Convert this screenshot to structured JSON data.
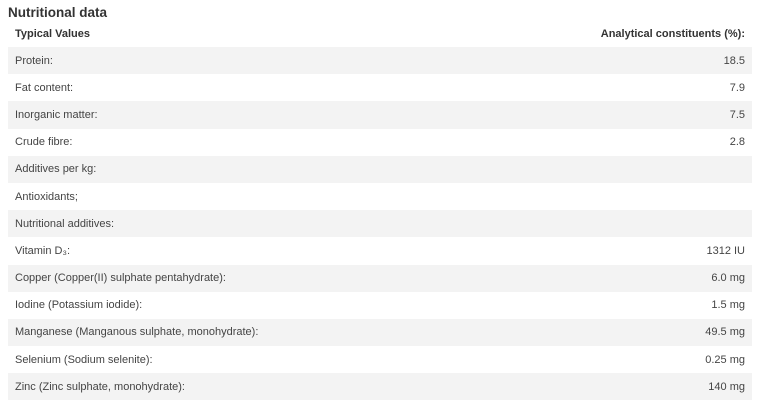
{
  "title": "Nutritional data",
  "table": {
    "header": {
      "label": "Typical Values",
      "value": "Analytical constituents (%):"
    },
    "rows": [
      {
        "label": "Protein:",
        "value": "18.5"
      },
      {
        "label": "Fat content:",
        "value": "7.9"
      },
      {
        "label": "Inorganic matter:",
        "value": "7.5"
      },
      {
        "label": "Crude fibre:",
        "value": "2.8"
      },
      {
        "label": "Additives per kg:",
        "value": ""
      },
      {
        "label": "Antioxidants;",
        "value": ""
      },
      {
        "label": "Nutritional additives:",
        "value": ""
      },
      {
        "label": "Vitamin D₃:",
        "value": "1312 IU"
      },
      {
        "label": "Copper (Copper(II) sulphate pentahydrate):",
        "value": "6.0 mg"
      },
      {
        "label": "Iodine (Potassium iodide):",
        "value": "1.5 mg"
      },
      {
        "label": "Manganese (Manganous sulphate, monohydrate):",
        "value": "49.5 mg"
      },
      {
        "label": "Selenium (Sodium selenite):",
        "value": "0.25 mg"
      },
      {
        "label": "Zinc (Zinc sulphate, monohydrate):",
        "value": "140 mg"
      }
    ]
  }
}
